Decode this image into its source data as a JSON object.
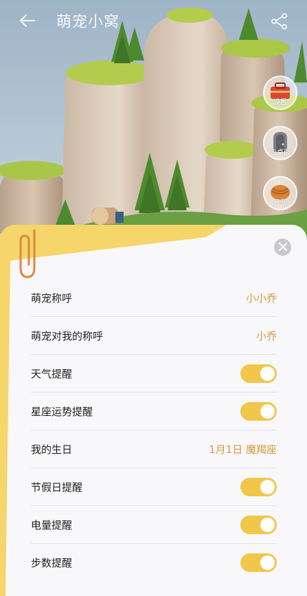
{
  "header": {
    "title": "萌宠小窝"
  },
  "side_buttons": [
    {
      "label": "设置",
      "icon": "toolbox-icon"
    },
    {
      "label": "去桌面",
      "icon": "door-icon"
    },
    {
      "label": "召回",
      "icon": "basket-icon"
    }
  ],
  "settings": {
    "rows": [
      {
        "label": "萌宠称呼",
        "value": "小小乔",
        "type": "value"
      },
      {
        "label": "萌宠对我的称呼",
        "value": "小乔",
        "type": "value"
      },
      {
        "label": "天气提醒",
        "type": "toggle",
        "on": true
      },
      {
        "label": "星座运势提醒",
        "type": "toggle",
        "on": true
      },
      {
        "label": "我的生日",
        "value": "1月1日 魔羯座",
        "type": "value"
      },
      {
        "label": "节假日提醒",
        "type": "toggle",
        "on": true
      },
      {
        "label": "电量提醒",
        "type": "toggle",
        "on": true
      },
      {
        "label": "步数提醒",
        "type": "toggle",
        "on": true
      }
    ]
  },
  "colors": {
    "accent": "#d59a3c",
    "toggle_on": "#f0c64b",
    "sheet_bg": "#f8f8fa"
  }
}
